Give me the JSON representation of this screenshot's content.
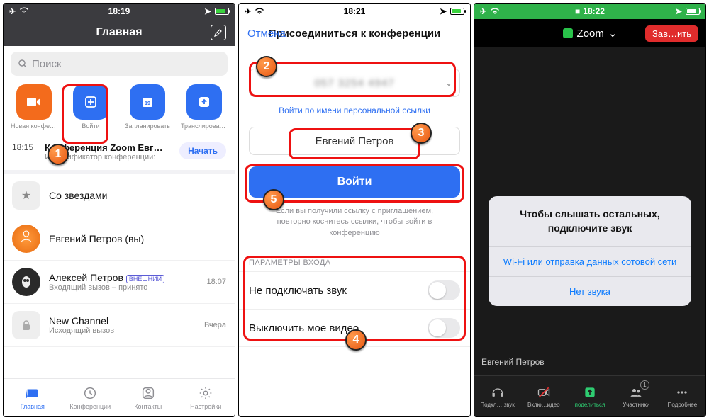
{
  "p1": {
    "time": "18:19",
    "title": "Главная",
    "search_placeholder": "Поиск",
    "quick": {
      "new": "Новая конференция",
      "join": "Войти",
      "schedule": "Запланировать",
      "share": "Транслировать э..."
    },
    "meeting": {
      "time": "18:15",
      "title": "Конференция Zoom Евгений Пе…",
      "sub": "Идентификатор конференции:",
      "start": "Начать"
    },
    "rows": {
      "starred": "Со звездами",
      "self_name": "Евгений Петров (вы)",
      "contact_name": "Алексей Петров",
      "tag": "ВНЕШНИЙ",
      "contact_sub": "Входящий вызов – принято",
      "contact_time": "18:07",
      "channel_name": "New Channel",
      "channel_sub": "Исходящий вызов",
      "channel_time": "Вчера"
    },
    "tabs": {
      "home": "Главная",
      "meet": "Конференции",
      "contacts": "Контакты",
      "settings": "Настройки"
    }
  },
  "p2": {
    "time": "18:21",
    "cancel": "Отмена",
    "title": "Присоединиться к конференции",
    "id_blur": "057 3254 4947",
    "link": "Войти по имени персональной ссылки",
    "name": "Евгений Петров",
    "join_btn": "Войти",
    "hint": "Если вы получили ссылку с приглашением, повторно коснитесь ссылки, чтобы войти в конференцию",
    "section": "ПАРАМЕТРЫ ВХОДА",
    "opt_audio": "Не подключать звук",
    "opt_video": "Выключить мое видео"
  },
  "p3": {
    "time": "18:22",
    "app": "Zoom",
    "end": "Зав…ить",
    "sheet_msg": "Чтобы слышать остальных, подключите звук",
    "sheet_opt1": "Wi-Fi или отправка данных сотовой сети",
    "sheet_opt2": "Нет звука",
    "user": "Евгений Петров",
    "tabs": {
      "audio": "Подкл… звук",
      "video": "Вклю…идео",
      "share": "поделиться",
      "part": "Участники",
      "more": "Подробнее"
    },
    "badge": "1"
  },
  "step": {
    "s1": "1",
    "s2": "2",
    "s3": "3",
    "s4": "4",
    "s5": "5"
  }
}
